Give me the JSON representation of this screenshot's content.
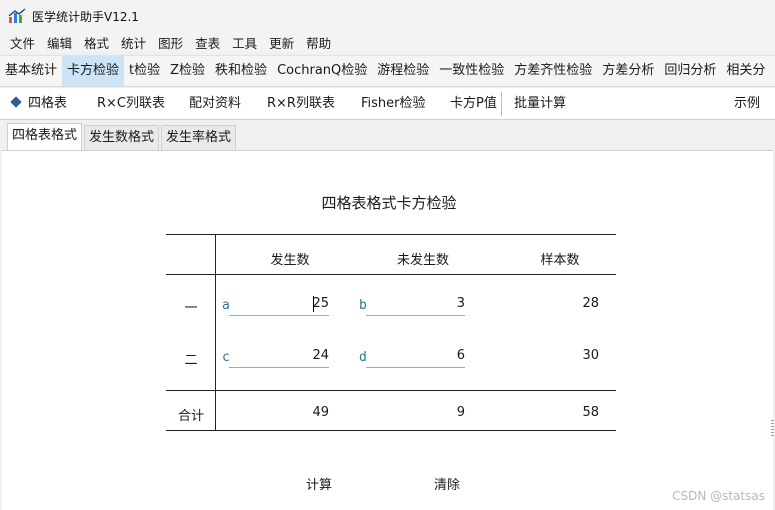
{
  "window": {
    "title": "医学统计助手V12.1"
  },
  "menu": [
    "文件",
    "编辑",
    "格式",
    "统计",
    "图形",
    "查表",
    "工具",
    "更新",
    "帮助"
  ],
  "main_tabs": [
    {
      "label": "基本统计",
      "active": false
    },
    {
      "label": "卡方检验",
      "active": true
    },
    {
      "label": "t检验",
      "active": false
    },
    {
      "label": "Z检验",
      "active": false
    },
    {
      "label": "秩和检验",
      "active": false
    },
    {
      "label": "CochranQ检验",
      "active": false
    },
    {
      "label": "游程检验",
      "active": false
    },
    {
      "label": "一致性检验",
      "active": false
    },
    {
      "label": "方差齐性检验",
      "active": false
    },
    {
      "label": "方差分析",
      "active": false
    },
    {
      "label": "回归分析",
      "active": false
    },
    {
      "label": "相关分",
      "active": false
    }
  ],
  "sub_tabs": {
    "fourfold": "四格表",
    "rxc": "R×C列联表",
    "paired": "配对资料",
    "rxr": "R×R列联表",
    "fisher": "Fisher检验",
    "chi_p": "卡方P值",
    "batch": "批量计算",
    "example": "示例"
  },
  "format_tabs": {
    "fourfold_format": "四格表格式",
    "count_format": "发生数格式",
    "rate_format": "发生率格式"
  },
  "form": {
    "title": "四格表格式卡方检验",
    "headers": {
      "occur": "发生数",
      "not_occur": "未发生数",
      "sample": "样本数"
    },
    "rows": [
      {
        "label": "一",
        "letter_a": "a",
        "value_a": "25",
        "letter_b": "b",
        "value_b": "3",
        "total": "28"
      },
      {
        "label": "二",
        "letter_a": "c",
        "value_a": "24",
        "letter_b": "d",
        "value_b": "6",
        "total": "30"
      }
    ],
    "sum_row": {
      "label": "合计",
      "occur": "49",
      "not_occur": "9",
      "total": "58"
    }
  },
  "buttons": {
    "calculate": "计算",
    "clear": "清除"
  },
  "watermark": "CSDN @statsas"
}
